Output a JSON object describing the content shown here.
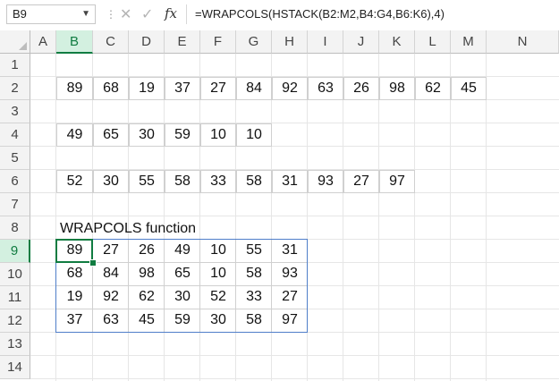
{
  "formula_bar": {
    "name_box": "B9",
    "formula": "=WRAPCOLS(HSTACK(B2:M2,B4:G4,B6:K6),4)",
    "fx_label": "fx",
    "cancel_glyph": "✕",
    "enter_glyph": "✓"
  },
  "columns": [
    "A",
    "B",
    "C",
    "D",
    "E",
    "F",
    "G",
    "H",
    "I",
    "J",
    "K",
    "L",
    "M",
    "N"
  ],
  "rows": [
    "1",
    "2",
    "3",
    "4",
    "5",
    "6",
    "7",
    "8",
    "9",
    "10",
    "11",
    "12",
    "13",
    "14"
  ],
  "row2": [
    "89",
    "68",
    "19",
    "37",
    "27",
    "84",
    "92",
    "63",
    "26",
    "98",
    "62",
    "45"
  ],
  "row4": [
    "49",
    "65",
    "30",
    "59",
    "10",
    "10"
  ],
  "row6": [
    "52",
    "30",
    "55",
    "58",
    "33",
    "58",
    "31",
    "93",
    "27",
    "97"
  ],
  "label": "WRAPCOLS function",
  "result": [
    [
      "89",
      "27",
      "26",
      "49",
      "10",
      "55",
      "31"
    ],
    [
      "68",
      "84",
      "98",
      "65",
      "10",
      "58",
      "93"
    ],
    [
      "19",
      "92",
      "62",
      "30",
      "52",
      "33",
      "27"
    ],
    [
      "37",
      "63",
      "45",
      "59",
      "30",
      "58",
      "97"
    ]
  ],
  "colors": {
    "accent": "#107c41",
    "spill_border": "#4f7ec9"
  }
}
